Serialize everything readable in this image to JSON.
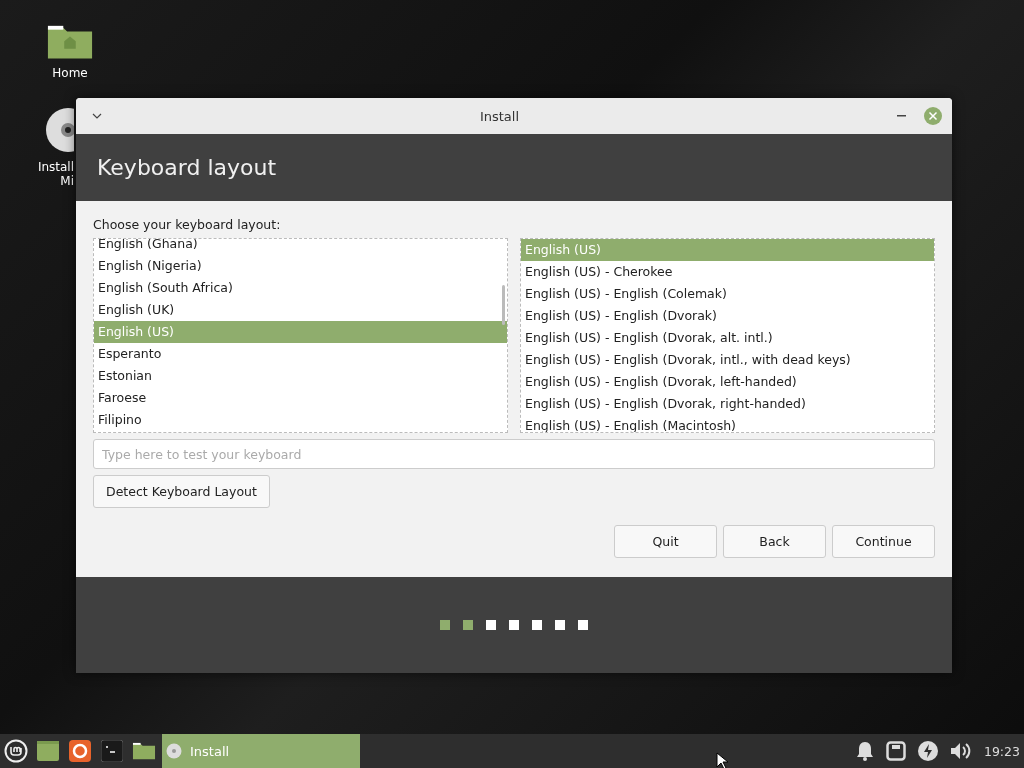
{
  "desktop_icons": [
    {
      "kind": "folder",
      "label_lines": [
        "Home"
      ]
    },
    {
      "kind": "disc",
      "label_lines": [
        "Install",
        "Mi"
      ]
    }
  ],
  "window": {
    "title": "Install",
    "heading": "Keyboard layout",
    "prompt": "Choose your keyboard layout:",
    "layouts": [
      {
        "label": "English (Ghana)",
        "selected": false
      },
      {
        "label": "English (Nigeria)",
        "selected": false
      },
      {
        "label": "English (South Africa)",
        "selected": false
      },
      {
        "label": "English (UK)",
        "selected": false
      },
      {
        "label": "English (US)",
        "selected": true
      },
      {
        "label": "Esperanto",
        "selected": false
      },
      {
        "label": "Estonian",
        "selected": false
      },
      {
        "label": "Faroese",
        "selected": false
      },
      {
        "label": "Filipino",
        "selected": false
      }
    ],
    "variants": [
      {
        "label": "English (US)",
        "selected": true
      },
      {
        "label": "English (US) - Cherokee",
        "selected": false
      },
      {
        "label": "English (US) - English (Colemak)",
        "selected": false
      },
      {
        "label": "English (US) - English (Dvorak)",
        "selected": false
      },
      {
        "label": "English (US) - English (Dvorak, alt. intl.)",
        "selected": false
      },
      {
        "label": "English (US) - English (Dvorak, intl., with dead keys)",
        "selected": false
      },
      {
        "label": "English (US) - English (Dvorak, left-handed)",
        "selected": false
      },
      {
        "label": "English (US) - English (Dvorak, right-handed)",
        "selected": false
      },
      {
        "label": "English (US) - English (Macintosh)",
        "selected": false
      }
    ],
    "test_field": {
      "placeholder": "Type here to test your keyboard"
    },
    "detect_button": "Detect Keyboard Layout",
    "buttons": [
      "Quit",
      "Back",
      "Continue"
    ],
    "steps": [
      {
        "done": true
      },
      {
        "done": true
      },
      {
        "done": false
      },
      {
        "done": false
      },
      {
        "done": false
      },
      {
        "done": false
      },
      {
        "done": false
      }
    ]
  },
  "taskbar": {
    "window_button": {
      "label": "Install",
      "selected": true
    },
    "clock": "19:23"
  }
}
